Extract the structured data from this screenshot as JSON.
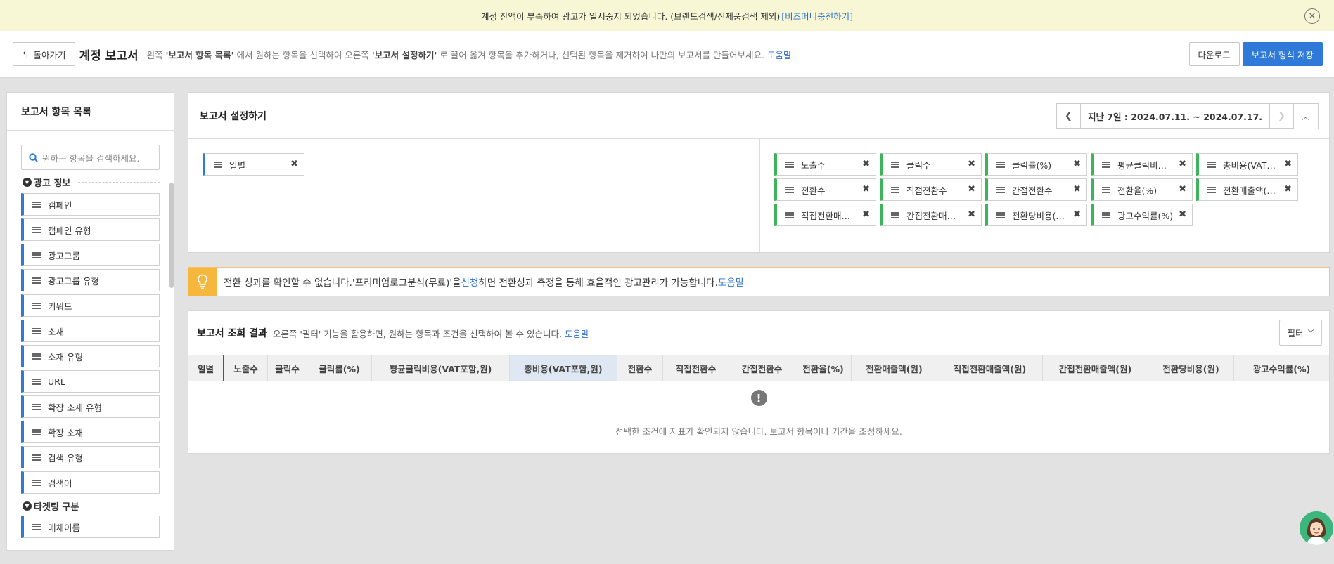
{
  "notice": {
    "text": "계정 잔액이 부족하여 광고가 일시중지 되었습니다. (브랜드검색/신제품검색 제외)",
    "link": "[비즈머니충전하기]"
  },
  "header": {
    "back_label": "돌아가기",
    "title": "계정 보고서",
    "desc_1": "왼쪽 ",
    "desc_bold_1": "'보고서 항목 목록'",
    "desc_2": " 에서 원하는 항목을 선택하여 오른쪽 ",
    "desc_bold_2": "'보고서 설정하기'",
    "desc_3": " 로 끌어 옮겨 항목을 추가하거나, 선택된 항목을 제거하여 나만의 보고서를 만들어보세요.",
    "help": "도움말",
    "download_label": "다운로드",
    "save_label": "보고서 형식 저장"
  },
  "sidebar": {
    "title": "보고서 항목 목록",
    "search_placeholder": "원하는 항목을 검색하세요.",
    "group1": "광고 정보",
    "items": [
      "캠페인",
      "캠페인 유형",
      "광고그룹",
      "광고그룹 유형",
      "키워드",
      "소재",
      "소재 유형",
      "URL",
      "확장 소재 유형",
      "확장 소재",
      "검색 유형",
      "검색어"
    ],
    "group2": "타겟팅 구분",
    "items2": [
      "매체이름"
    ]
  },
  "settings": {
    "title": "보고서 설정하기",
    "date_range": "지난 7일 : 2024.07.11. ~ 2024.07.17.",
    "row_chip": "일별",
    "columns": [
      "노출수",
      "클릭수",
      "클릭률(%)",
      "평균클릭비용(VAT포함,원)",
      "총비용(VAT포함,원)",
      "전환수",
      "직접전환수",
      "간접전환수",
      "전환율(%)",
      "전환매출액(원)",
      "직접전환매출액(원)",
      "간접전환매출액(원)",
      "전환당비용(원)",
      "광고수익률(%)"
    ],
    "column_display": [
      "노출수",
      "클릭수",
      "클릭률(%)",
      "평균클릭비…",
      "총비용(VAT…",
      "전환수",
      "직접전환수",
      "간접전환수",
      "전환율(%)",
      "전환매출액(…",
      "직접전환매…",
      "간접전환매…",
      "전환당비용(…",
      "광고수익률(%)"
    ]
  },
  "alert": {
    "text_1": "전환 성과를 확인할 수 없습니다.'프리미엄로그분석(무료)'을 ",
    "link_1": "신청",
    "text_2": "하면 전환성과 측정을 통해 효율적인 광고관리가 가능합니다. ",
    "link_2": "도움말"
  },
  "results": {
    "title": "보고서 조회 결과",
    "desc": "오른쪽 '필터' 기능을 활용하면, 원하는 항목과 조건을 선택하여 볼 수 있습니다. ",
    "help": "도움말",
    "filter_label": "필터",
    "headers": [
      "일별",
      "노출수",
      "클릭수",
      "클릭률(%)",
      "평균클릭비용(VAT포함,원)",
      "총비용(VAT포함,원)",
      "전환수",
      "직접전환수",
      "간접전환수",
      "전환율(%)",
      "전환매출액(원)",
      "직접전환매출액(원)",
      "간접전환매출액(원)",
      "전환당비용(원)",
      "광고수익률(%)"
    ],
    "empty_message": "선택한 조건에 지표가 확인되지 않습니다. 보고서 항목이나 기간을 조정하세요."
  },
  "colors": {
    "accent": "#2f7ad8",
    "metric_chip": "#3cb45a",
    "alert": "#f6b73c",
    "notice_bg": "#f7f7d6"
  }
}
